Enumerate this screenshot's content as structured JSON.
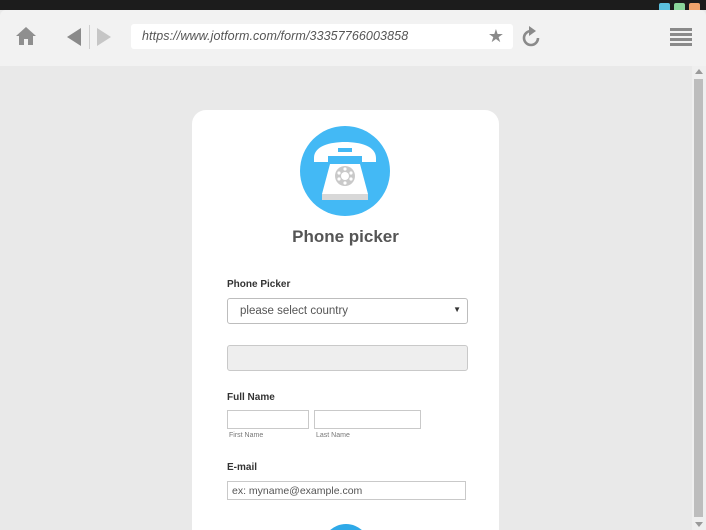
{
  "browser": {
    "url": "https://www.jotform.com/form/33357766003858",
    "window_colors": [
      "#5bc0de",
      "#8ad69a",
      "#f0a36b"
    ]
  },
  "form": {
    "title": "Phone picker",
    "phone_picker": {
      "label": "Phone Picker",
      "select_value": "please select country"
    },
    "full_name": {
      "label": "Full Name",
      "first_sublabel": "First Name",
      "last_sublabel": "Last Name"
    },
    "email": {
      "label": "E-mail",
      "placeholder": "ex: myname@example.com"
    }
  },
  "colors": {
    "accent": "#43b9f5",
    "page_bg": "#e9e9e9"
  }
}
